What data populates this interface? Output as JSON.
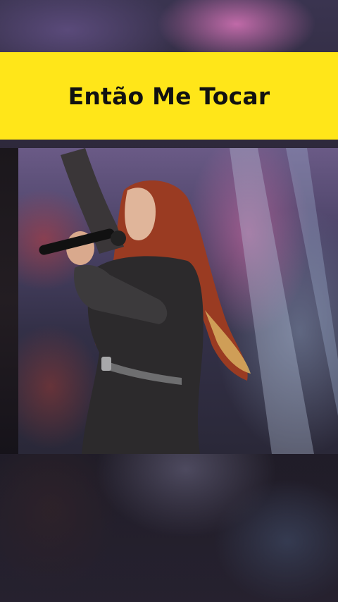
{
  "banner": {
    "title": "Então Me Tocar"
  },
  "colors": {
    "banner_background": "#ffe619",
    "banner_text": "#111111"
  },
  "photo": {
    "subject": "singer-with-microphone"
  }
}
